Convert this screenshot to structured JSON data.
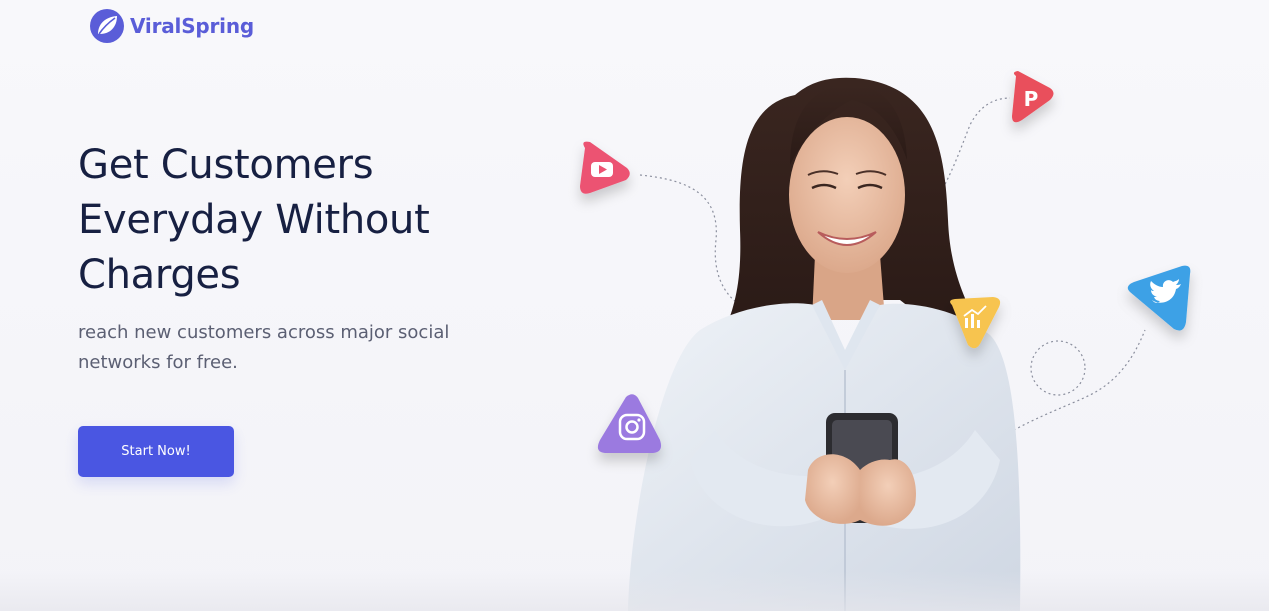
{
  "brand": {
    "name": "ViralSpring",
    "color": "#5a5dd8",
    "icon": "leaf-icon"
  },
  "hero": {
    "title_lines": [
      "Get Customers",
      "Everyday Without",
      "Charges"
    ],
    "subtitle_lines": [
      "reach new customers across major social",
      "networks for free."
    ],
    "cta_label": "Start Now!"
  },
  "colors": {
    "heading": "#172042",
    "body_text": "#5b5f73",
    "button": "#4a56e2",
    "youtube": "#ec5272",
    "pinterest": "#e94f5b",
    "instagram": "#9b7ae0",
    "analytics": "#f7c44f",
    "twitter": "#3da1e6"
  },
  "social_badges": [
    {
      "name": "youtube-icon"
    },
    {
      "name": "pinterest-icon"
    },
    {
      "name": "instagram-icon"
    },
    {
      "name": "analytics-icon"
    },
    {
      "name": "twitter-icon"
    }
  ]
}
